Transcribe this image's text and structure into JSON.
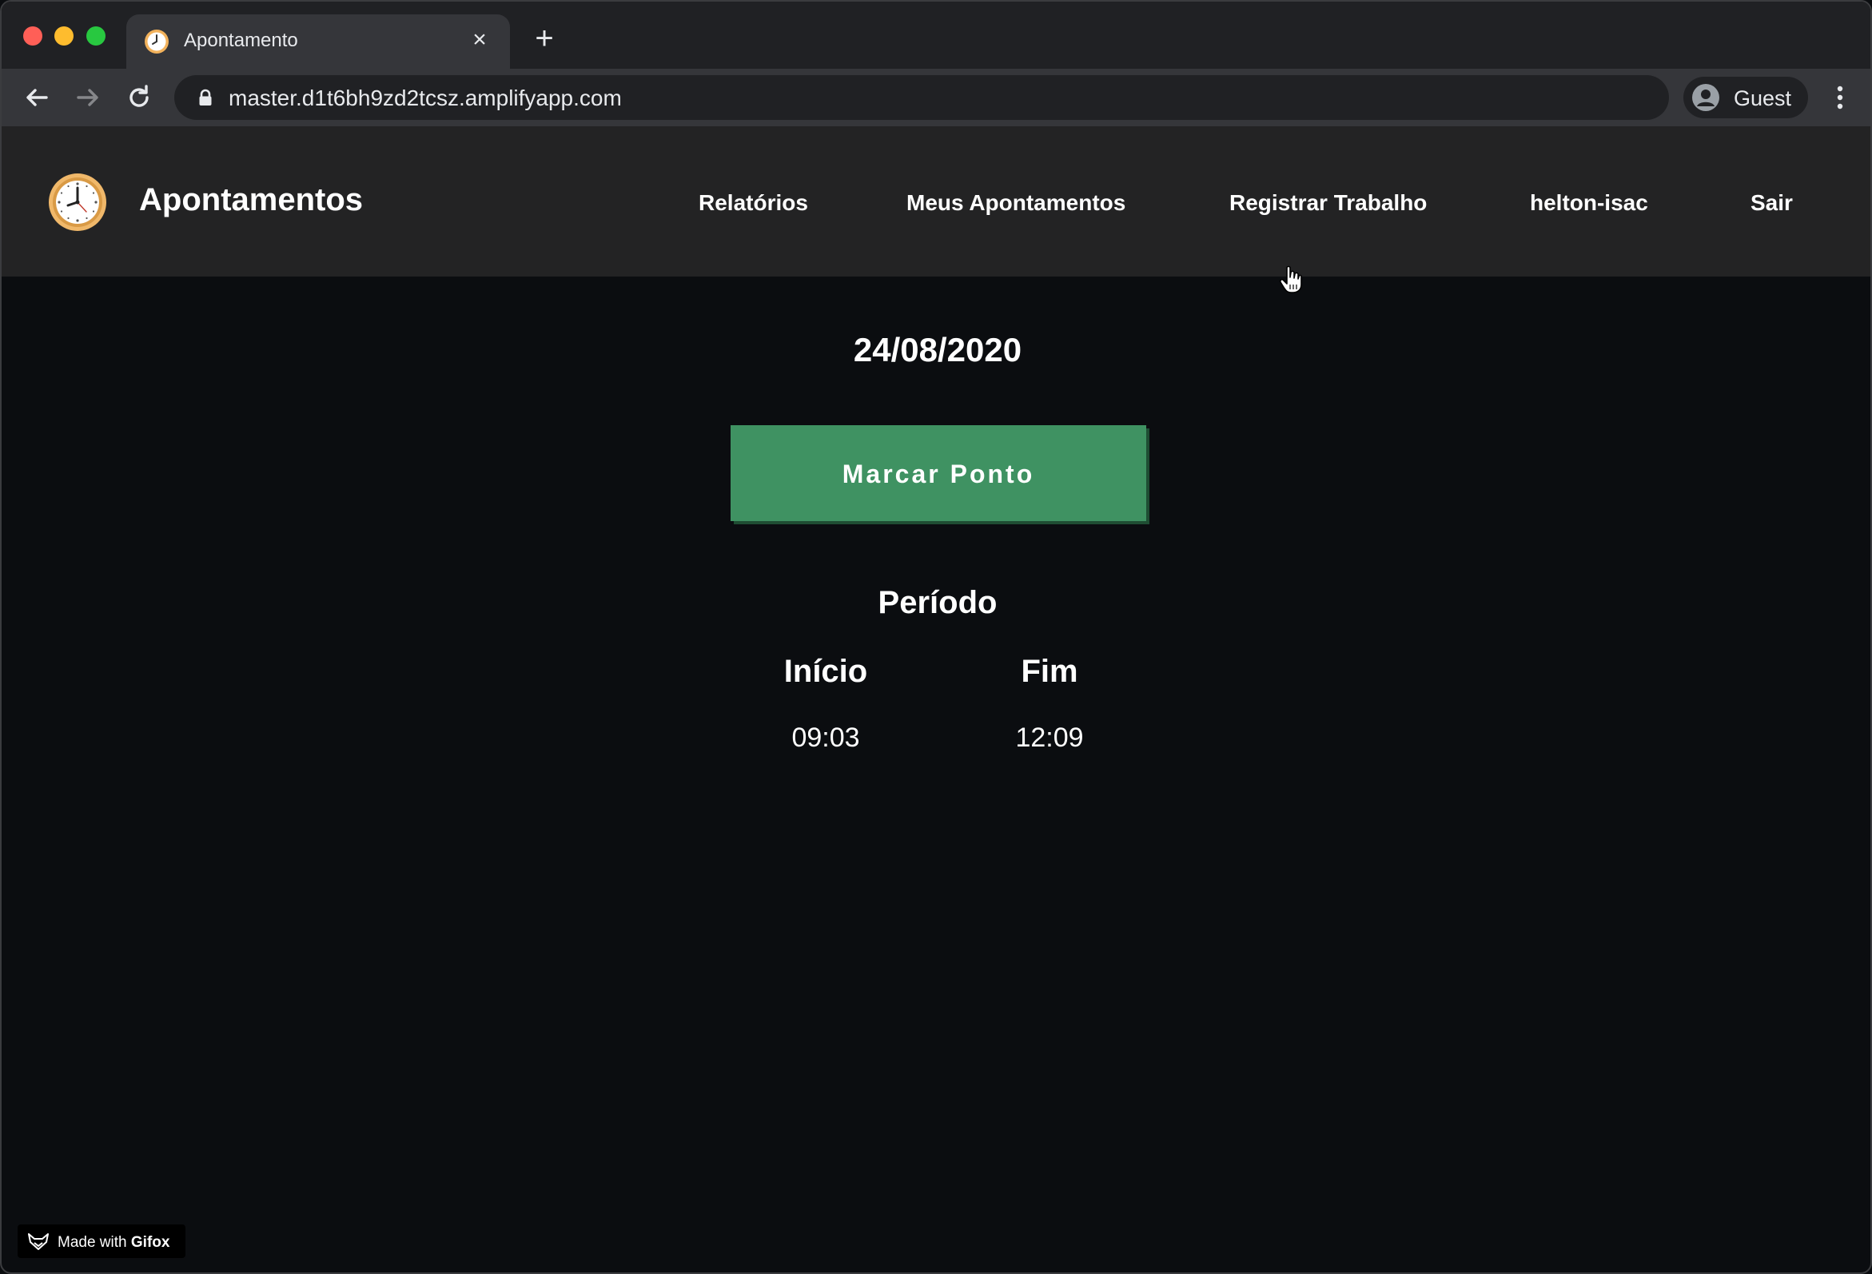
{
  "browser": {
    "tab_title": "Apontamento",
    "url": "master.d1t6bh9zd2tcsz.amplifyapp.com",
    "profile_label": "Guest"
  },
  "app": {
    "title": "Apontamentos",
    "nav": [
      {
        "label": "Relatórios"
      },
      {
        "label": "Meus Apontamentos"
      },
      {
        "label": "Registrar Trabalho"
      },
      {
        "label": "helton-isac"
      },
      {
        "label": "Sair"
      }
    ]
  },
  "main": {
    "date": "24/08/2020",
    "button_label": "Marcar Ponto",
    "period_title": "Período",
    "columns": [
      "Início",
      "Fim"
    ],
    "rows": [
      {
        "inicio": "09:03",
        "fim": "12:09"
      }
    ]
  },
  "watermark": {
    "prefix": "Made with",
    "brand": "Gifox"
  },
  "colors": {
    "accent_button": "#3f9262",
    "header_bg": "#232324",
    "page_bg": "#0b0d10"
  }
}
